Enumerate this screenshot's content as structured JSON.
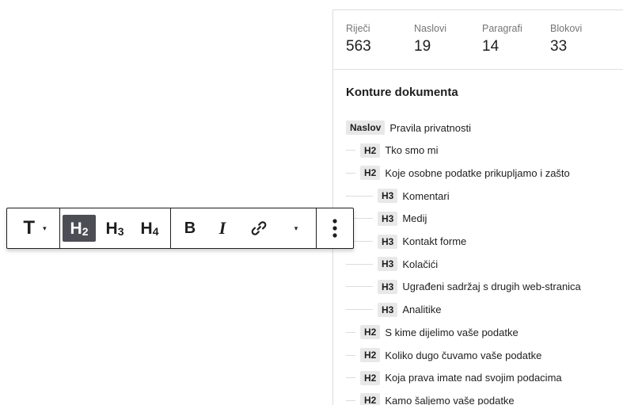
{
  "toolbar": {
    "block_type_icon": "T",
    "block_type_caret": "▾",
    "headings": [
      {
        "letter": "H",
        "level": "2",
        "active": true
      },
      {
        "letter": "H",
        "level": "3",
        "active": false
      },
      {
        "letter": "H",
        "level": "4",
        "active": false
      }
    ],
    "bold_label": "B",
    "italic_label": "I",
    "link_icon": "link-icon",
    "more_caret": "▾",
    "options_icon": "kebab-menu-icon"
  },
  "stats": [
    {
      "label": "Riječi",
      "value": "563"
    },
    {
      "label": "Naslovi",
      "value": "19"
    },
    {
      "label": "Paragrafi",
      "value": "14"
    },
    {
      "label": "Blokovi",
      "value": "33"
    }
  ],
  "outline": {
    "title": "Konture dokumenta",
    "items": [
      {
        "level": "Naslov",
        "text": "Pravila privatnosti"
      },
      {
        "level": "H2",
        "text": "Tko smo mi"
      },
      {
        "level": "H2",
        "text": "Koje osobne podatke prikupljamo i zašto"
      },
      {
        "level": "H3",
        "text": "Komentari"
      },
      {
        "level": "H3",
        "text": "Medij"
      },
      {
        "level": "H3",
        "text": "Kontakt forme"
      },
      {
        "level": "H3",
        "text": "Kolačići"
      },
      {
        "level": "H3",
        "text": "Ugrađeni sadržaj s drugih web-stranica"
      },
      {
        "level": "H3",
        "text": "Analitike"
      },
      {
        "level": "H2",
        "text": "S kime dijelimo vaše podatke"
      },
      {
        "level": "H2",
        "text": "Koliko dugo čuvamo vaše podatke"
      },
      {
        "level": "H2",
        "text": "Koja prava imate nad svojim podacima"
      },
      {
        "level": "H2",
        "text": "Kamo šaljemo vaše podatke"
      }
    ]
  }
}
